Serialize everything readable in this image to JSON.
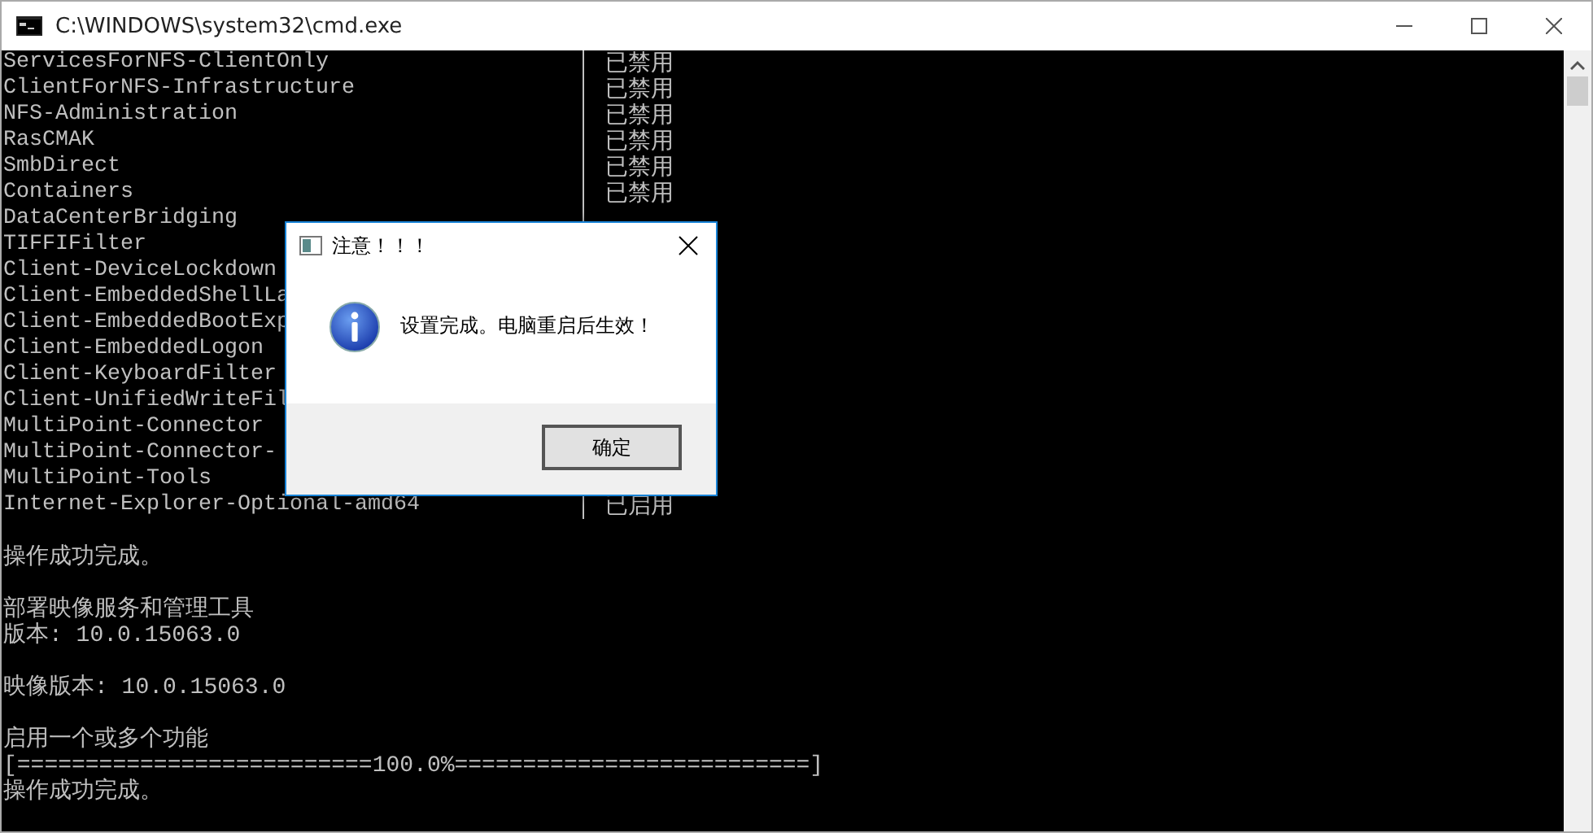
{
  "window": {
    "title": "C:\\WINDOWS\\system32\\cmd.exe"
  },
  "console": {
    "features": [
      {
        "name": "ServicesForNFS-ClientOnly",
        "status": "已禁用"
      },
      {
        "name": "ClientForNFS-Infrastructure",
        "status": "已禁用"
      },
      {
        "name": "NFS-Administration",
        "status": "已禁用"
      },
      {
        "name": "RasCMAK",
        "status": "已禁用"
      },
      {
        "name": "SmbDirect",
        "status": "已禁用"
      },
      {
        "name": "Containers",
        "status": "已禁用"
      },
      {
        "name": "DataCenterBridging"
      },
      {
        "name": "TIFFIFilter"
      },
      {
        "name": "Client-DeviceLockdown"
      },
      {
        "name": "Client-EmbeddedShellLa"
      },
      {
        "name": "Client-EmbeddedBootExp"
      },
      {
        "name": "Client-EmbeddedLogon"
      },
      {
        "name": "Client-KeyboardFilter"
      },
      {
        "name": "Client-UnifiedWriteFil"
      },
      {
        "name": "MultiPoint-Connector"
      },
      {
        "name": "MultiPoint-Connector-"
      },
      {
        "name": "MultiPoint-Tools"
      },
      {
        "name": "Internet-Explorer-Optional-amd64",
        "status": "已启用"
      }
    ],
    "blocks": [
      [
        "操作成功完成。"
      ],
      [
        "部署映像服务和管理工具",
        "版本: 10.0.15063.0"
      ],
      [
        "映像版本: 10.0.15063.0"
      ],
      [
        "启用一个或多个功能",
        "[==========================100.0%==========================]",
        "操作成功完成。"
      ]
    ]
  },
  "dialog": {
    "title": "注意！！！",
    "message": "设置完成。电脑重启后生效！",
    "button": "确定"
  }
}
